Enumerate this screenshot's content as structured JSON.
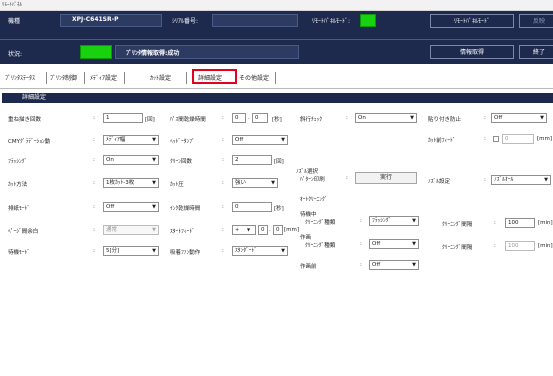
{
  "window": {
    "title": "ﾘﾓｰﾄﾊﾟﾈﾙ"
  },
  "header": {
    "model_label": "機種",
    "model_value": "XPJ-C641SR-P",
    "serial_label": "ｼﾘｱﾙ番号:",
    "remote_mode_label": "ﾘﾓｰﾄﾊﾟﾈﾙﾓｰﾄﾞ:",
    "status_label": "状況:",
    "status_text": "ﾌﾟﾘﾝﾀ情報取得:成功",
    "remote_mode_button": "ﾘﾓｰﾄﾊﾟﾈﾙﾓｰﾄﾞ",
    "apply_button": "反映",
    "get_info_button": "情報取得",
    "exit_button": "終了",
    "indicator_color": "#18d10f"
  },
  "tabs": [
    "ﾌﾟﾘﾝﾀｽﾃｰﾀｽ",
    "ﾌﾟﾘﾝﾀ制御",
    "ﾒﾃﾞｨｱ設定",
    "ｶｯﾄ設定",
    "詳細設定",
    "その他設定"
  ],
  "active_tab": "詳細設定",
  "panel_title": "詳細設定",
  "col1": [
    {
      "label": "重ね描き回数",
      "value": "1",
      "unit": "[回]"
    },
    {
      "label": "CMYｸﾞﾗﾃﾞｰｼｮﾝ動",
      "value": "ﾒﾃﾞｨｱ幅"
    },
    {
      "label": "ﾌﾗｯｼﾝｸﾞ",
      "value": "On"
    },
    {
      "label": "ｶｯﾄ方法",
      "value": "1枚ｶｯﾄ-3枚"
    },
    {
      "label": "排紙ﾓｰﾄﾞ",
      "value": "Off"
    },
    {
      "label": "ﾍﾟｰｼﾞ間余白",
      "value": "通常"
    },
    {
      "label": "待機ﾓｰﾄﾞ",
      "value": "5[分]"
    }
  ],
  "col2": [
    {
      "label": "ﾊﾟｽ間乾燥時間",
      "value1": "0",
      "value2": "0",
      "unit": "[秒]"
    },
    {
      "label": "ﾍｯﾄﾞｰﾀﾝﾌﾟ",
      "value": "Off"
    },
    {
      "label": "ｸﾘｰﾝ回数",
      "value": "2",
      "unit": "[回]"
    },
    {
      "label": "ｶｯﾄ圧",
      "value": "強い"
    },
    {
      "label": "ｲﾝｸ乾燥時間",
      "value": "0",
      "unit": "[秒]"
    },
    {
      "label": "ｽﾀｰﾄﾌｨｰﾄﾞ",
      "sign": "+",
      "value1": "0",
      "value2": "0",
      "unit": "[mm]"
    },
    {
      "label": "吸着ﾌｧﾝ動作",
      "value": "ｽﾀﾝﾀﾞｰﾄﾞ"
    }
  ],
  "col3": {
    "media_check_label": "斜行ﾁｪｯｸ",
    "media_check_value": "On",
    "nozzle_group_label": "ﾉｽﾞﾙ選択",
    "pattern_print_label": "ﾊﾟﾀｰﾝ印刷",
    "execute_button": "実行",
    "auto_cleaning_label": "ｵｰﾄｸﾘｰﾆﾝｸﾞ",
    "standby_label": "待機中",
    "standby_type_label": "ｸﾘｰﾆﾝｸﾞ種類",
    "standby_type_value": "ﾌﾗｯｼﾝｸﾞ",
    "printing_label": "作画",
    "printing_type_label": "ｸﾘｰﾆﾝｸﾞ種類",
    "printing_type_value": "Off",
    "before_print_label": "作画前",
    "before_print_value": "Off"
  },
  "col4": {
    "paste_stop_label": "貼り付き防止",
    "paste_stop_value": "Off",
    "cut_feed_label": "ｶｯﾄ前ﾌｨｰﾄﾞ",
    "cut_feed_value": "0",
    "cut_feed_unit": "[mm]",
    "nozzle_setting_label": "ﾉｽﾞﾙ設定",
    "nozzle_setting_value": "ﾉｽﾞﾙｵｰﾙ",
    "interval1_label": "ｸﾘｰﾆﾝｸﾞ間隔",
    "interval1_value": "100",
    "interval1_unit": "[min]",
    "interval2_label": "ｸﾘｰﾆﾝｸﾞ間隔",
    "interval2_value": "100",
    "interval2_unit": "[min]"
  }
}
